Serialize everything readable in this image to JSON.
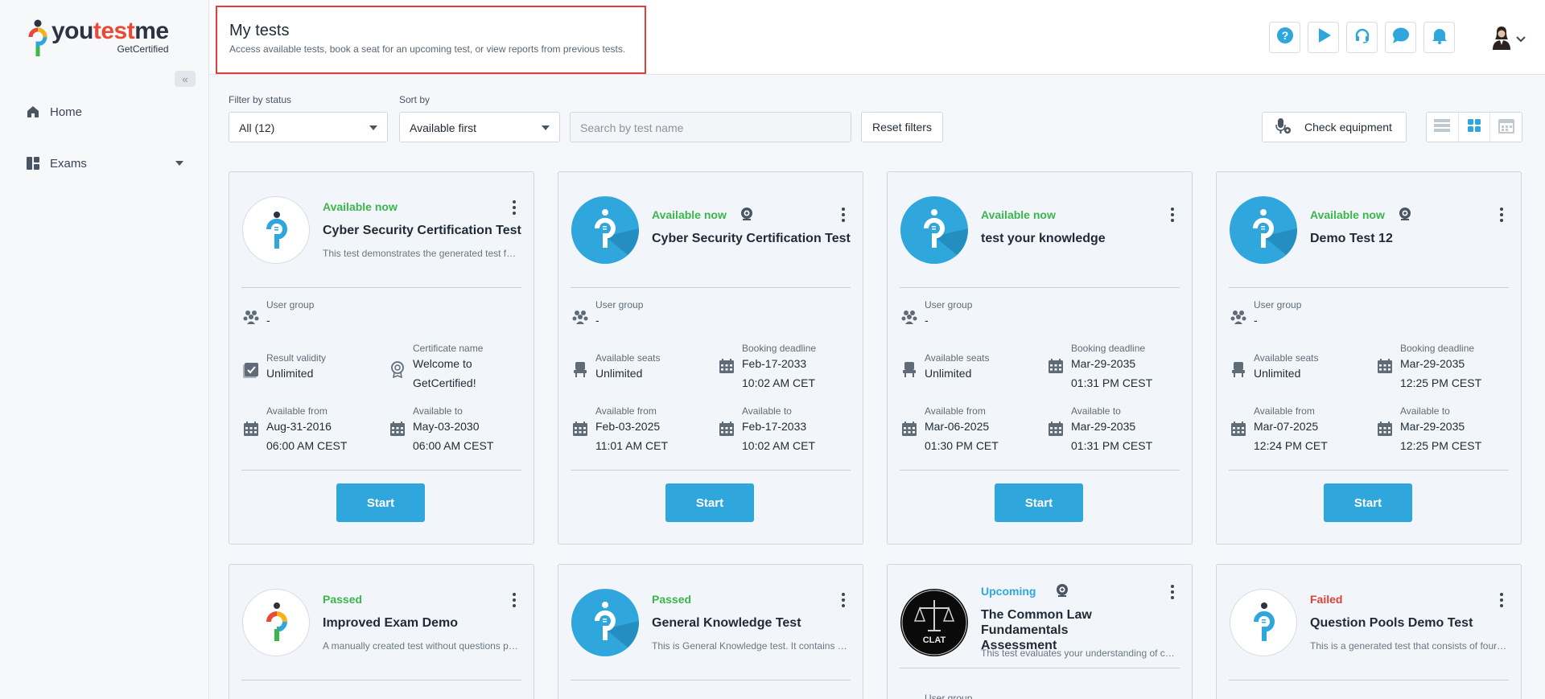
{
  "brand": {
    "name_part1": "you",
    "name_part2": "test",
    "name_part3": "me",
    "sub": "GetCertified",
    "accent": "#2fa6dc"
  },
  "sidebar": {
    "collapse_glyph": "«",
    "items": [
      {
        "label": "Home",
        "icon": "home-icon"
      },
      {
        "label": "Exams",
        "icon": "exams-icon"
      }
    ]
  },
  "header": {
    "title": "My tests",
    "subtitle": "Access available tests, book a seat for an upcoming test, or view reports from previous tests.",
    "icons": [
      "help-icon",
      "play-icon",
      "headset-icon",
      "chat-icon",
      "bell-icon"
    ]
  },
  "filters": {
    "status_label": "Filter by status",
    "status_value": "All (12)",
    "sort_label": "Sort by",
    "sort_value": "Available first",
    "search_placeholder": "Search by test name",
    "reset_label": "Reset filters",
    "check_equipment_label": "Check equipment"
  },
  "labels": {
    "user_group": "User group",
    "result_validity": "Result validity",
    "certificate_name": "Certificate name",
    "available_seats": "Available seats",
    "booking_deadline": "Booking deadline",
    "available_from": "Available from",
    "available_to": "Available to",
    "start": "Start"
  },
  "colors": {
    "available": "#3cb54a",
    "upcoming": "#2fa6dc",
    "failed": "#e0403a"
  },
  "cards": [
    {
      "status": "Available now",
      "title": "Cyber Security Certification Test",
      "desc": "This test demonstrates the generated test functionality",
      "user_group": "-",
      "mid_left_value": "Unlimited",
      "mid_right_value1": "Welcome to",
      "mid_right_value2": "GetCertified!",
      "from_date": "Aug-31-2016",
      "from_time": "06:00 AM CEST",
      "to_date": "May-03-2030",
      "to_time": "06:00 AM CEST"
    },
    {
      "status": "Available now",
      "title": "Cyber Security Certification Test",
      "user_group": "-",
      "mid_left_value": "Unlimited",
      "mid_right_value1": "Feb-17-2033",
      "mid_right_value2": "10:02 AM CET",
      "from_date": "Feb-03-2025",
      "from_time": "11:01 AM CET",
      "to_date": "Feb-17-2033",
      "to_time": "10:02 AM CET"
    },
    {
      "status": "Available now",
      "title": "test your knowledge",
      "user_group": "-",
      "mid_left_value": "Unlimited",
      "mid_right_value1": "Mar-29-2035",
      "mid_right_value2": "01:31 PM CEST",
      "from_date": "Mar-06-2025",
      "from_time": "01:30 PM CET",
      "to_date": "Mar-29-2035",
      "to_time": "01:31 PM CEST"
    },
    {
      "status": "Available now",
      "title": "Demo Test 12",
      "user_group": "-",
      "mid_left_value": "Unlimited",
      "mid_right_value1": "Mar-29-2035",
      "mid_right_value2": "12:25 PM CEST",
      "from_date": "Mar-07-2025",
      "from_time": "12:24 PM CET",
      "to_date": "Mar-29-2035",
      "to_time": "12:25 PM CEST"
    },
    {
      "status": "Passed",
      "title": "Improved Exam Demo",
      "desc": "A manually created test without questions pools"
    },
    {
      "status": "Passed",
      "title": "General Knowledge Test",
      "desc": "This is General Knowledge test. It contains questions"
    },
    {
      "status": "Upcoming",
      "title_line1": "The Common Law Fundamentals",
      "title_line2": "Assessment",
      "desc": "This test evaluates your understanding of common law",
      "logo_text": "CLAT",
      "user_group_label": "User group"
    },
    {
      "status": "Failed",
      "title": "Question Pools Demo Test",
      "desc": "This is a generated test that consists of four pools"
    }
  ]
}
